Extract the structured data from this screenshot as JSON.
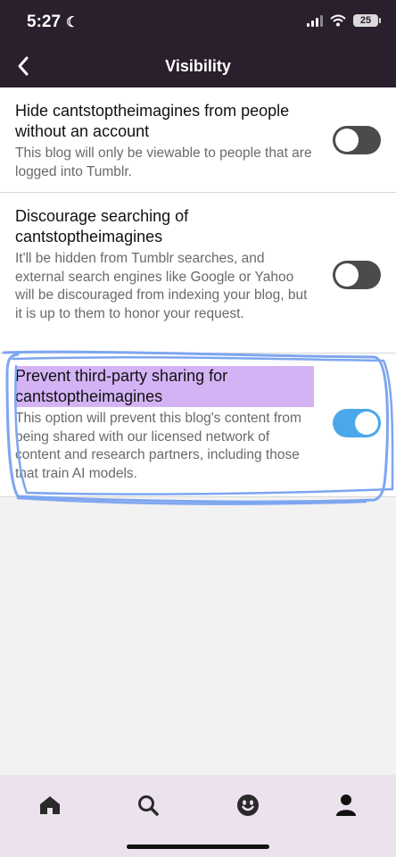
{
  "status_bar": {
    "time": "5:27",
    "battery": "25"
  },
  "header": {
    "title": "Visibility"
  },
  "settings": [
    {
      "title": "Hide cantstoptheimagines from people without an account",
      "description": "This blog will only be viewable to people that are logged into Tumblr.",
      "enabled": false
    },
    {
      "title": "Discourage searching of cantstoptheimagines",
      "description": "It'll be hidden from Tumblr searches, and external search engines like Google or Yahoo will be discouraged from indexing your blog, but it is up to them to honor your request.",
      "enabled": false
    },
    {
      "title": "Prevent third-party sharing for cantstoptheimagines",
      "description": "This option will prevent this blog's content from being shared with our licensed network of content and research partners, including those that train AI models.",
      "enabled": true
    }
  ],
  "tabbar": {
    "items": [
      {
        "icon": "home-icon"
      },
      {
        "icon": "search-icon"
      },
      {
        "icon": "activity-face-icon"
      },
      {
        "icon": "account-icon"
      }
    ]
  },
  "colors": {
    "header_bg": "#2a1f2c",
    "toggle_on": "#4aa8ea",
    "toggle_off": "#4b4b4b",
    "tabbar_bg": "#ece2ee",
    "highlight": "#d4b3f5",
    "annotation": "#7ea6f0"
  }
}
